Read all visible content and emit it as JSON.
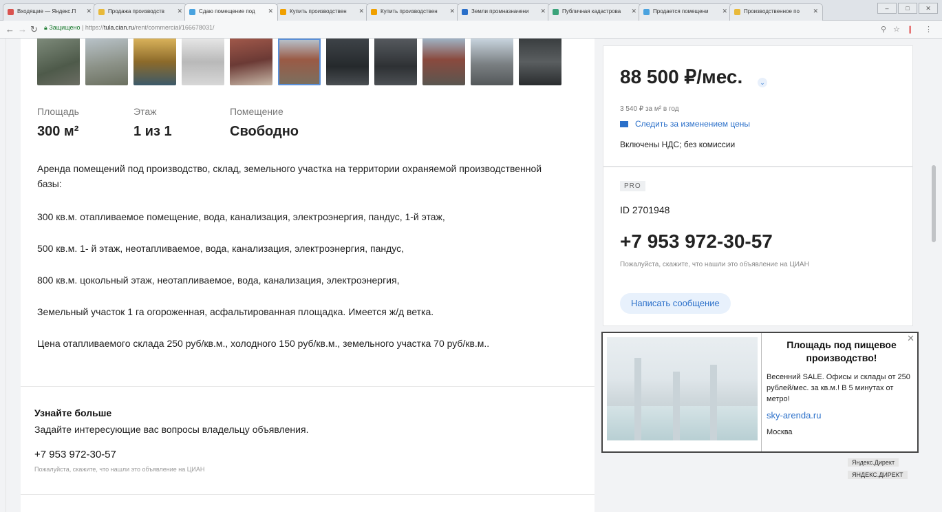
{
  "browser": {
    "tabs": [
      {
        "label": "Входящие — Яндекс.П",
        "color": "#d9534f",
        "active": false
      },
      {
        "label": "Продажа производств",
        "color": "#e8b93a",
        "active": false
      },
      {
        "label": "Сдаю помещение под",
        "color": "#4aa3df",
        "active": true
      },
      {
        "label": "Купить производствен",
        "color": "#f0a000",
        "active": false
      },
      {
        "label": "Купить производствен",
        "color": "#f0a000",
        "active": false
      },
      {
        "label": "Земли промназначени",
        "color": "#2a6fc9",
        "active": false
      },
      {
        "label": "Публичная кадастрова",
        "color": "#3aa37a",
        "active": false
      },
      {
        "label": "Продается помещени",
        "color": "#4aa3df",
        "active": false
      },
      {
        "label": "Производственное по",
        "color": "#e8b93a",
        "active": false
      }
    ],
    "secure_label": "Защищено",
    "url_scheme": "https://",
    "url_host": "tula.cian.ru",
    "url_path": "/rent/commercial/166678031/"
  },
  "listing": {
    "facts": [
      {
        "label": "Площадь",
        "value": "300 м²"
      },
      {
        "label": "Этаж",
        "value": "1 из 1"
      },
      {
        "label": "Помещение",
        "value": "Свободно"
      }
    ],
    "description": [
      "Аренда помещений под производство, склад, земельного участка на территории охраняемой производственной базы:",
      "300 кв.м. отапливаемое помещение, вода, канализация, электроэнергия, пандус, 1-й этаж,",
      "500 кв.м. 1- й этаж, неотапливаемое, вода, канализация, электроэнергия, пандус,",
      "800 кв.м. цокольный этаж, неотапливаемое, вода, канализация, электроэнергия,",
      "Земельный участок 1 га огороженная, асфальтированная площадка. Имеется ж/д ветка.",
      "Цена отапливаемого склада 250 руб/кв.м., холодного 150 руб/кв.м., земельного участка 70 руб/кв.м.."
    ],
    "learn_more": {
      "title": "Узнайте больше",
      "subtitle": "Задайте интересующие вас вопросы владельцу объявления.",
      "phone": "+7 953 972-30-57",
      "hint": "Пожалуйста, скажите, что нашли это объявление на ЦИАН"
    }
  },
  "price_card": {
    "price": "88 500 ₽/мес.",
    "per_sqm": "3 540 ₽ за м² в год",
    "follow_label": "Следить за изменением цены",
    "terms": "Включены НДС; без комиссии"
  },
  "contact_card": {
    "badge": "PRO",
    "id_label": "ID 2701948",
    "phone": "+7 953 972-30-57",
    "hint": "Пожалуйста, скажите, что нашли это объявление на ЦИАН",
    "message_button": "Написать сообщение"
  },
  "ad": {
    "title": "Площадь под пищевое производство!",
    "text": "Весенний SALE. Офисы и склады от 250 рублей/мес. за кв.м.! В 5 минутах от метро!",
    "link": "sky-arenda.ru",
    "city": "Москва",
    "footer1": "Яндекс.Директ",
    "footer2": "ЯНДЕКС.ДИРЕКТ"
  }
}
